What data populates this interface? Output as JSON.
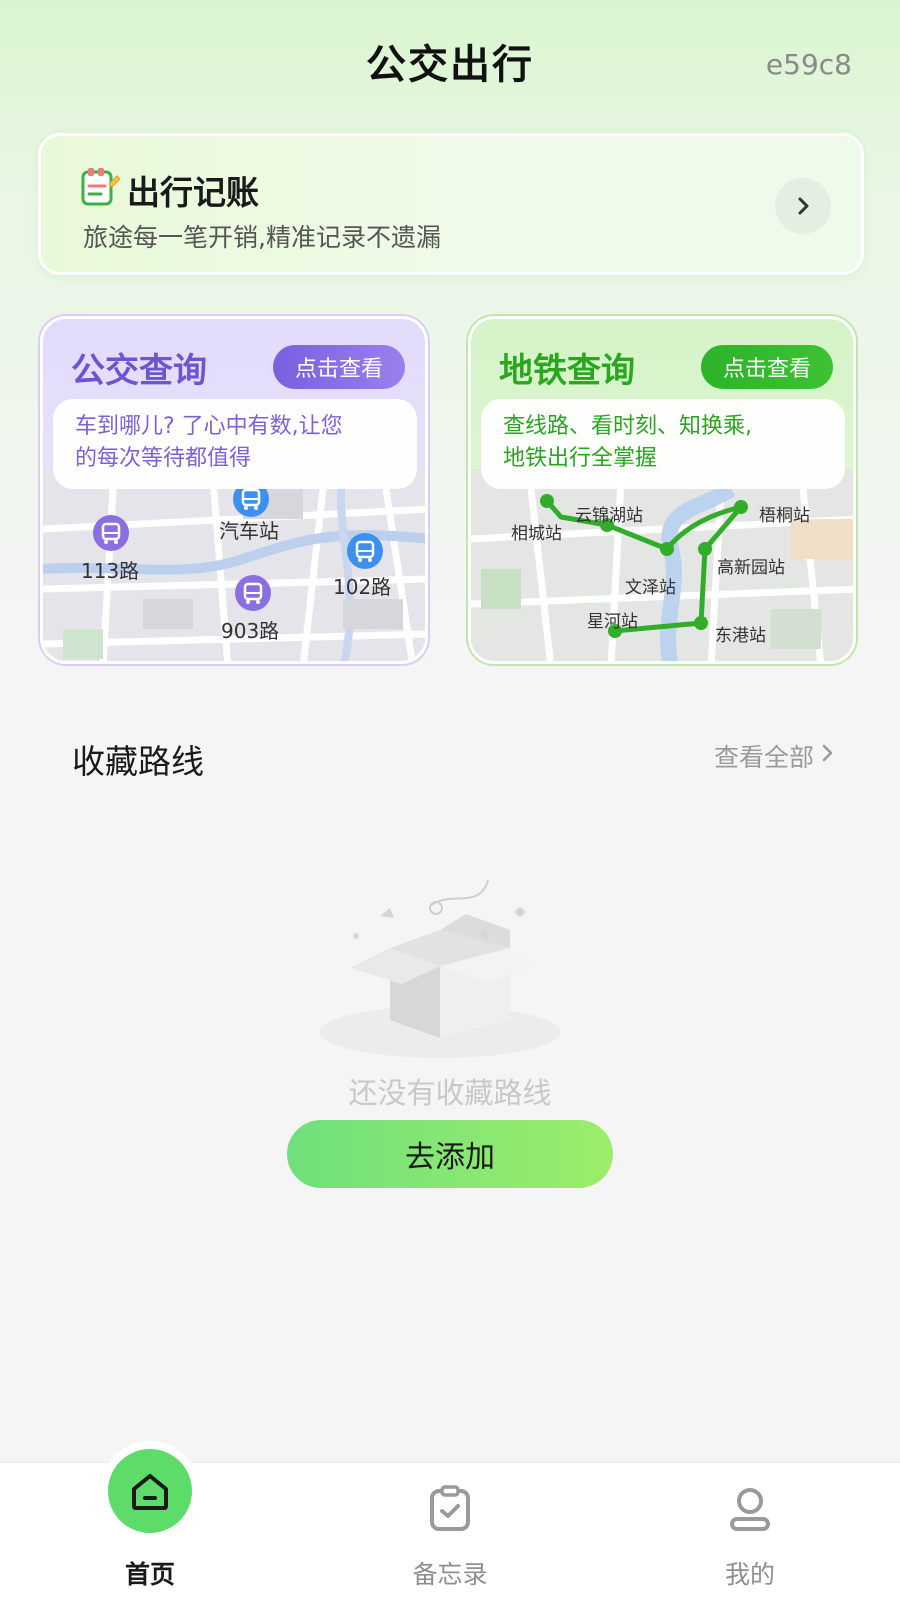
{
  "header": {
    "title": "公交出行",
    "code": "e59c8"
  },
  "banner": {
    "title": "出行记账",
    "subtitle": "旅途每一笔开销,精准记录不遗漏",
    "icon": "notepad-icon",
    "arrow_icon": "chevron-right-icon"
  },
  "bus_card": {
    "title": "公交查询",
    "button": "点击查看",
    "bubble_line1": "车到哪儿? 了心中有数,让您",
    "bubble_line2": "的每次等待都值得",
    "stops": [
      "汽车站",
      "113路",
      "102路",
      "903路"
    ],
    "accent": "#7a5fe0"
  },
  "metro_card": {
    "title": "地铁查询",
    "button": "点击查看",
    "bubble_line1": "查线路、看时刻、知换乘,",
    "bubble_line2": "地铁出行全掌握",
    "stations": [
      "云锦湖站",
      "相城站",
      "梧桐站",
      "高新园站",
      "文泽站",
      "星河站",
      "东港站"
    ],
    "accent": "#2db32a"
  },
  "favorites": {
    "title": "收藏路线",
    "more": "查看全部",
    "more_icon": "chevron-right-icon",
    "empty_text": "还没有收藏路线",
    "add_button": "去添加"
  },
  "bottom_nav": {
    "items": [
      {
        "label": "首页",
        "icon": "home-icon",
        "active": true
      },
      {
        "label": "备忘录",
        "icon": "memo-icon",
        "active": false
      },
      {
        "label": "我的",
        "icon": "user-icon",
        "active": false
      }
    ]
  }
}
